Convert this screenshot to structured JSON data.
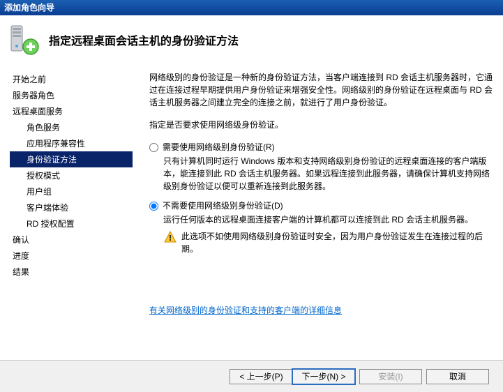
{
  "window": {
    "title": "添加角色向导"
  },
  "header": {
    "title": "指定远程桌面会话主机的身份验证方法"
  },
  "sidebar": {
    "items": [
      {
        "label": "开始之前",
        "indent": false
      },
      {
        "label": "服务器角色",
        "indent": false
      },
      {
        "label": "远程桌面服务",
        "indent": false
      },
      {
        "label": "角色服务",
        "indent": true
      },
      {
        "label": "应用程序兼容性",
        "indent": true
      },
      {
        "label": "身份验证方法",
        "indent": true,
        "selected": true
      },
      {
        "label": "授权模式",
        "indent": true
      },
      {
        "label": "用户组",
        "indent": true
      },
      {
        "label": "客户端体验",
        "indent": true
      },
      {
        "label": "RD 授权配置",
        "indent": true
      },
      {
        "label": "确认",
        "indent": false
      },
      {
        "label": "进度",
        "indent": false
      },
      {
        "label": "结果",
        "indent": false
      }
    ]
  },
  "main": {
    "intro": "网络级别的身份验证是一种新的身份验证方法，当客户端连接到 RD 会话主机服务器时，它通过在连接过程早期提供用户身份验证来增强安全性。网络级别的身份验证在远程桌面与 RD 会话主机服务器之间建立完全的连接之前，就进行了用户身份验证。",
    "prompt": "指定是否要求使用网络级身份验证。",
    "option1": {
      "label": "需要使用网络级别身份验证(R)",
      "desc": "只有计算机同时运行 Windows 版本和支持网络级别身份验证的远程桌面连接的客户端版本，能连接到此 RD 会话主机服务器。如果远程连接到此服务器，请确保计算机支持网络级别身份验证以便可以重新连接到此服务器。"
    },
    "option2": {
      "label": "不需要使用网络级别身份验证(D)",
      "desc": "运行任何版本的远程桌面连接客户端的计算机都可以连接到此 RD 会话主机服务器。",
      "warning": "此选项不如使用网络级别身份验证时安全，因为用户身份验证发生在连接过程的后期。"
    },
    "link": "有关网络级别的身份验证和支持的客户端的详细信息"
  },
  "footer": {
    "prev": "< 上一步(P)",
    "next": "下一步(N) >",
    "install": "安装(I)",
    "cancel": "取消"
  }
}
